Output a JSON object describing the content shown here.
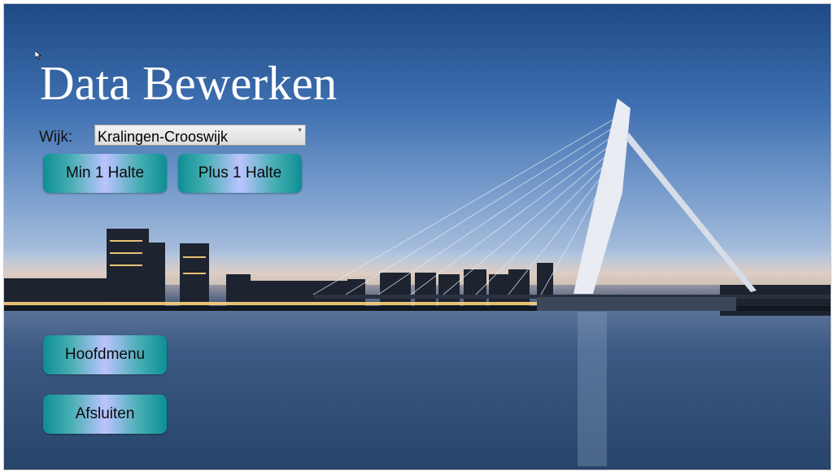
{
  "page": {
    "title": "Data Bewerken"
  },
  "form": {
    "wijk_label": "Wijk:",
    "wijk_selected": "Kralingen-Crooswijk"
  },
  "buttons": {
    "min_halte": "Min 1 Halte",
    "plus_halte": "Plus 1 Halte",
    "hoofdmenu": "Hoofdmenu",
    "afsluiten": "Afsluiten"
  },
  "colors": {
    "button_edge": "#0d8f93",
    "button_center": "#bcc3ff",
    "title": "#ffffff"
  },
  "background": {
    "icon": "rotterdam-erasmus-bridge-photo"
  }
}
